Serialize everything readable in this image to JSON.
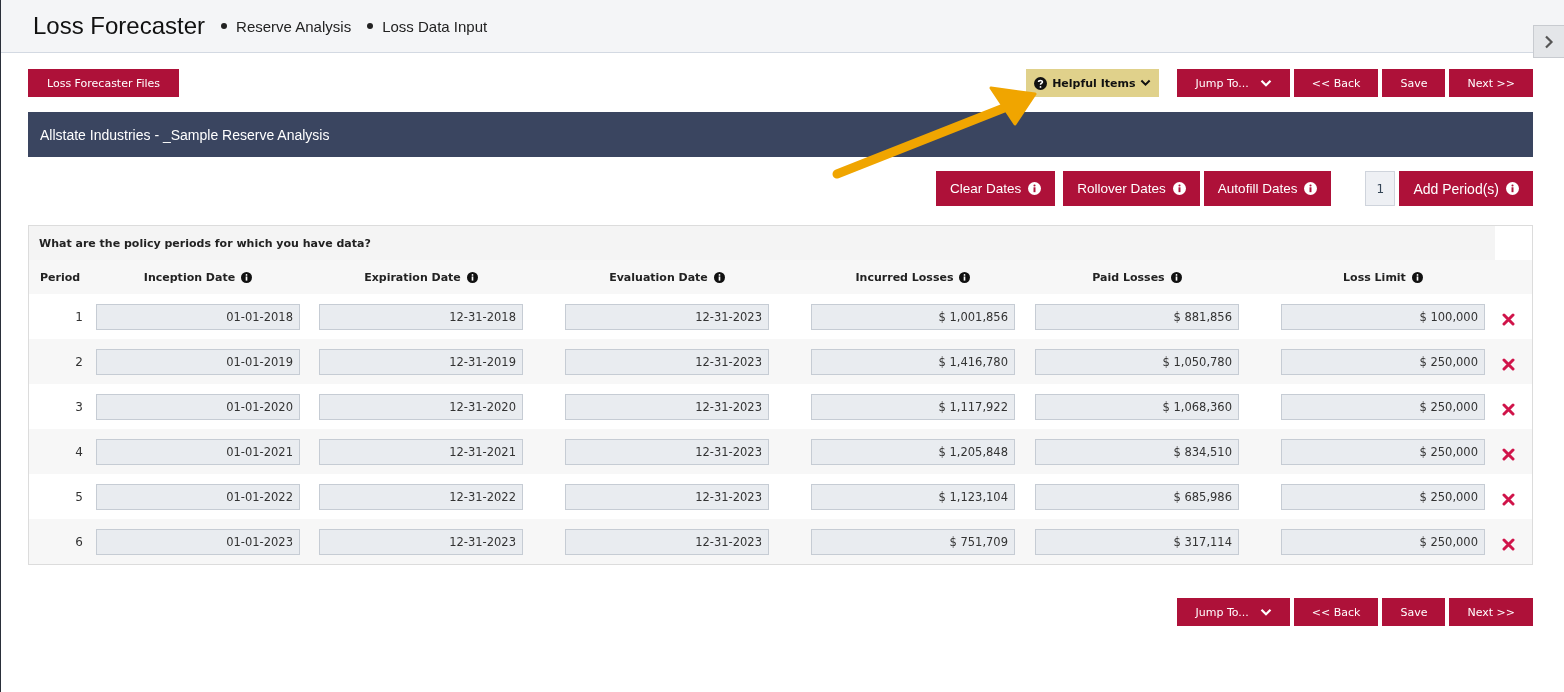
{
  "header": {
    "title": "Loss Forecaster",
    "breadcrumbs": [
      "Reserve Analysis",
      "Loss Data Input"
    ]
  },
  "files_button": "Loss Forecaster Files",
  "helpful_items": "Helpful Items",
  "nav_top": [
    {
      "label": "Jump To...",
      "kind": "dropdown"
    },
    {
      "label": "<< Back",
      "kind": "plain"
    },
    {
      "label": "Save",
      "kind": "plain"
    },
    {
      "label": "Next >>",
      "kind": "plain"
    }
  ],
  "banner": "Allstate Industries - _Sample Reserve Analysis",
  "date_actions": [
    "Clear Dates",
    "Rollover Dates",
    "Autofill Dates"
  ],
  "period_count": "1",
  "add_button": "Add Period(s)",
  "table": {
    "question": "What are the policy periods for which you have data?",
    "columns": [
      {
        "label": "Period",
        "info": false
      },
      {
        "label": "Inception Date",
        "info": true
      },
      {
        "label": "Expiration Date",
        "info": true
      },
      {
        "label": "Evaluation Date",
        "info": true
      },
      {
        "label": "Incurred Losses",
        "info": true
      },
      {
        "label": "Paid Losses",
        "info": true
      },
      {
        "label": "Loss Limit",
        "info": true
      }
    ],
    "rows": [
      {
        "period": "1",
        "cells": [
          "01-01-2018",
          "12-31-2018",
          "12-31-2023",
          "$ 1,001,856",
          "$ 881,856",
          "$ 100,000"
        ]
      },
      {
        "period": "2",
        "cells": [
          "01-01-2019",
          "12-31-2019",
          "12-31-2023",
          "$ 1,416,780",
          "$ 1,050,780",
          "$ 250,000"
        ]
      },
      {
        "period": "3",
        "cells": [
          "01-01-2020",
          "12-31-2020",
          "12-31-2023",
          "$ 1,117,922",
          "$ 1,068,360",
          "$ 250,000"
        ]
      },
      {
        "period": "4",
        "cells": [
          "01-01-2021",
          "12-31-2021",
          "12-31-2023",
          "$ 1,205,848",
          "$ 834,510",
          "$ 250,000"
        ]
      },
      {
        "period": "5",
        "cells": [
          "01-01-2022",
          "12-31-2022",
          "12-31-2023",
          "$ 1,123,104",
          "$ 685,986",
          "$ 250,000"
        ]
      },
      {
        "period": "6",
        "cells": [
          "01-01-2023",
          "12-31-2023",
          "12-31-2023",
          "$ 751,709",
          "$ 317,114",
          "$ 250,000"
        ]
      }
    ]
  },
  "nav_bottom": [
    {
      "label": "Jump To...",
      "kind": "dropdown"
    },
    {
      "label": "<< Back",
      "kind": "plain"
    },
    {
      "label": "Save",
      "kind": "plain"
    },
    {
      "label": "Next >>",
      "kind": "plain"
    }
  ]
}
